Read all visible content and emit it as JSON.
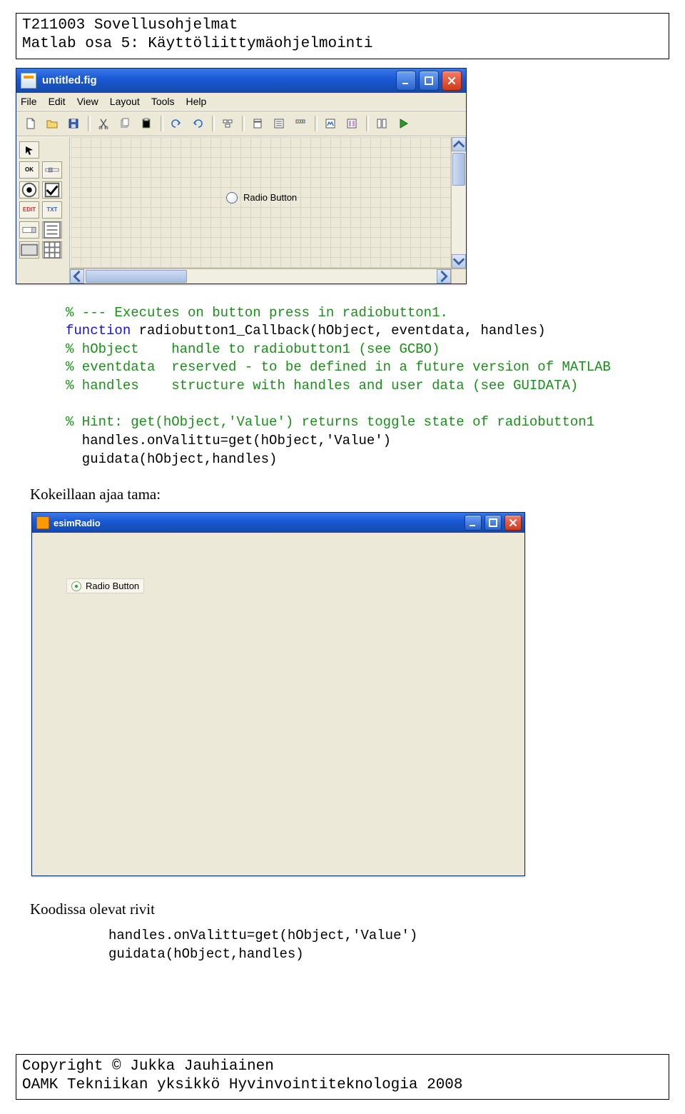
{
  "header": {
    "line1": "T211003 Sovellusohjelmat",
    "line2": "Matlab osa 5: Käyttöliittymäohjelmointi"
  },
  "guide": {
    "title": "untitled.fig",
    "menu": [
      "File",
      "Edit",
      "View",
      "Layout",
      "Tools",
      "Help"
    ],
    "palette": {
      "row2": [
        "OK",
        ""
      ],
      "row3": [
        "",
        ""
      ],
      "row4": [
        "EDIT",
        "TXT"
      ],
      "row5": [
        "",
        ""
      ]
    },
    "radioLabel": "Radio Button"
  },
  "codeblock1": {
    "lines": [
      "% --- Executes on button press in radiobutton1.",
      "function radiobutton1_Callback(hObject, eventdata, handles)",
      "% hObject    handle to radiobutton1 (see GCBO)",
      "% eventdata  reserved - to be defined in a future version of MATLAB",
      "% handles    structure with handles and user data (see GUIDATA)",
      "",
      "% Hint: get(hObject,'Value') returns toggle state of radiobutton1",
      "  handles.onValittu=get(hObject,'Value')",
      "  guidata(hObject,handles)"
    ]
  },
  "section1": "Kokeillaan ajaa tama:",
  "esim": {
    "title": "esimRadio",
    "radioLabel": "Radio Button"
  },
  "section2": "Koodissa olevat rivit",
  "codeblock2": {
    "lines": [
      "handles.onValittu=get(hObject,'Value')",
      "guidata(hObject,handles)"
    ]
  },
  "footer": {
    "line1": "Copyright © Jukka Jauhiainen",
    "line2": "OAMK Tekniikan yksikkö Hyvinvointiteknologia 2008"
  }
}
